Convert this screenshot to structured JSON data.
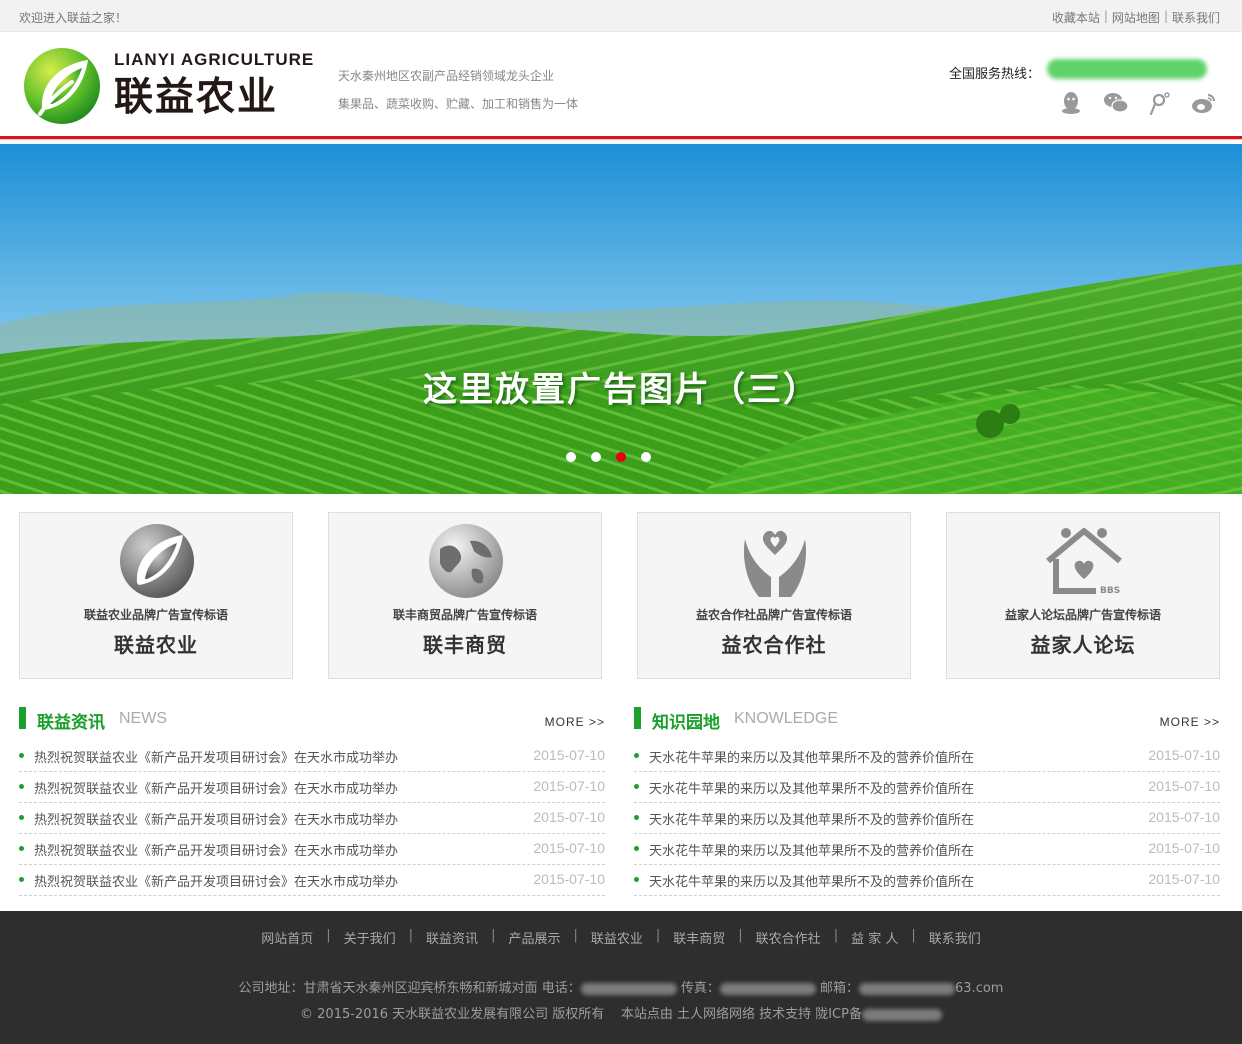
{
  "topbar": {
    "welcome": "欢迎进入联益之家！",
    "links": [
      "收藏本站",
      "网站地图",
      "联系我们"
    ]
  },
  "header": {
    "logo_en": "LIANYI AGRICULTURE",
    "logo_cn": "联益农业",
    "slogan1": "天水秦州地区农副产品经销领域龙头企业",
    "slogan2": "集果品、蔬菜收购、贮藏、加工和销售为一体",
    "hotline_label": "全国服务热线："
  },
  "banner": {
    "caption": "这里放置广告图片（三）",
    "active_slide": 3,
    "slide_count": 4
  },
  "brands": [
    {
      "tag": "联益农业品牌广告宣传标语",
      "name": "联益农业",
      "icon": "leaf-logo-icon"
    },
    {
      "tag": "联丰商贸品牌广告宣传标语",
      "name": "联丰商贸",
      "icon": "globe-icon"
    },
    {
      "tag": "益农合作社品牌广告宣传标语",
      "name": "益农合作社",
      "icon": "heart-hands-icon"
    },
    {
      "tag": "益家人论坛品牌广告宣传标语",
      "name": "益家人论坛",
      "icon": "bbs-house-icon"
    }
  ],
  "news": {
    "title": "联益资讯",
    "subtitle": "NEWS",
    "more": "MORE >>",
    "items": [
      {
        "text": "热烈祝贺联益农业《新产品开发项目研讨会》在天水市成功举办",
        "date": "2015-07-10"
      },
      {
        "text": "热烈祝贺联益农业《新产品开发项目研讨会》在天水市成功举办",
        "date": "2015-07-10"
      },
      {
        "text": "热烈祝贺联益农业《新产品开发项目研讨会》在天水市成功举办",
        "date": "2015-07-10"
      },
      {
        "text": "热烈祝贺联益农业《新产品开发项目研讨会》在天水市成功举办",
        "date": "2015-07-10"
      },
      {
        "text": "热烈祝贺联益农业《新产品开发项目研讨会》在天水市成功举办",
        "date": "2015-07-10"
      }
    ]
  },
  "knowledge": {
    "title": "知识园地",
    "subtitle": "KNOWLEDGE",
    "more": "MORE >>",
    "items": [
      {
        "text": "天水花牛苹果的来历以及其他苹果所不及的营养价值所在",
        "date": "2015-07-10"
      },
      {
        "text": "天水花牛苹果的来历以及其他苹果所不及的营养价值所在",
        "date": "2015-07-10"
      },
      {
        "text": "天水花牛苹果的来历以及其他苹果所不及的营养价值所在",
        "date": "2015-07-10"
      },
      {
        "text": "天水花牛苹果的来历以及其他苹果所不及的营养价值所在",
        "date": "2015-07-10"
      },
      {
        "text": "天水花牛苹果的来历以及其他苹果所不及的营养价值所在",
        "date": "2015-07-10"
      }
    ]
  },
  "footer": {
    "nav": [
      "网站首页",
      "关于我们",
      "联益资讯",
      "产品展示",
      "联益农业",
      "联丰商贸",
      "联农合作社",
      "益 家 人",
      "联系我们"
    ],
    "address": "公司地址：甘肃省天水秦州区迎宾桥东畅和新城对面",
    "phone_label": "电话：",
    "fax_label": "传真：",
    "email_label": "邮箱：",
    "email_suffix": "63.com",
    "copyright": "© 2015-2016 天水联益农业发展有限公司 版权所有",
    "support": "本站点由 土人网络网络 技术支持 陇ICP备"
  },
  "colors": {
    "accent_green": "#1aa02c",
    "header_red": "#d7161b",
    "footer_bg": "#2e2e2e",
    "active_dot": "#e60012"
  }
}
